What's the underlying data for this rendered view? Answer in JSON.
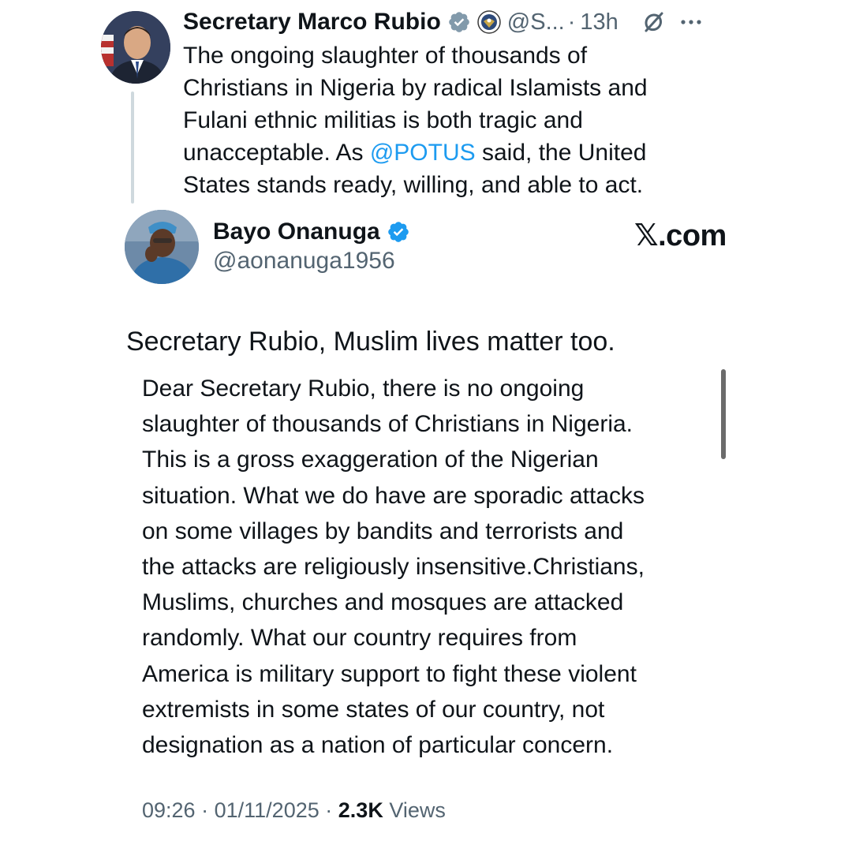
{
  "quoted": {
    "name": "Secretary Marco Rubio",
    "handle": "@S...",
    "separator": "·",
    "time": "13h",
    "lines": [
      "The ongoing slaughter of thousands of",
      "Christians in Nigeria by radical Islamists and",
      "Fulani ethnic militias is both tragic and"
    ],
    "line4_before": "unacceptable. As ",
    "mention": "@POTUS",
    "line4_after": " said, the United",
    "line5": "States stands ready, willing, and able to act."
  },
  "main": {
    "name": "Bayo Onanuga",
    "handle": "@aonanuga1956",
    "headline": "Secretary Rubio, Muslim lives matter too.",
    "lines": [
      "Dear Secretary Rubio, there is no ongoing",
      "slaughter of thousands of Christians in Nigeria.",
      "This is a gross exaggeration of the Nigerian",
      "situation. What we do have are sporadic attacks",
      "on some villages by bandits and terrorists and",
      "the attacks are religiously insensitive.Christians,",
      "Muslims, churches and mosques are attacked",
      "randomly. What our country requires from",
      "America is military support to fight these violent",
      "extremists in some states of our country, not",
      "designation as a nation of particular concern."
    ]
  },
  "watermark": {
    "x": "𝕏",
    "domain": ".com"
  },
  "meta": {
    "time": "09:26",
    "separator": "·",
    "date": "01/11/2025",
    "views_count": "2.3K",
    "views_label": "Views"
  },
  "colors": {
    "link": "#1d9bf0",
    "verified_blue": "#1d9bf0",
    "verified_gray": "#829aab",
    "secondary_text": "#536471"
  },
  "icons": [
    "gray-verified-badge-icon",
    "state-department-seal-icon",
    "grok-icon",
    "more-options-icon",
    "blue-verified-badge-icon"
  ]
}
